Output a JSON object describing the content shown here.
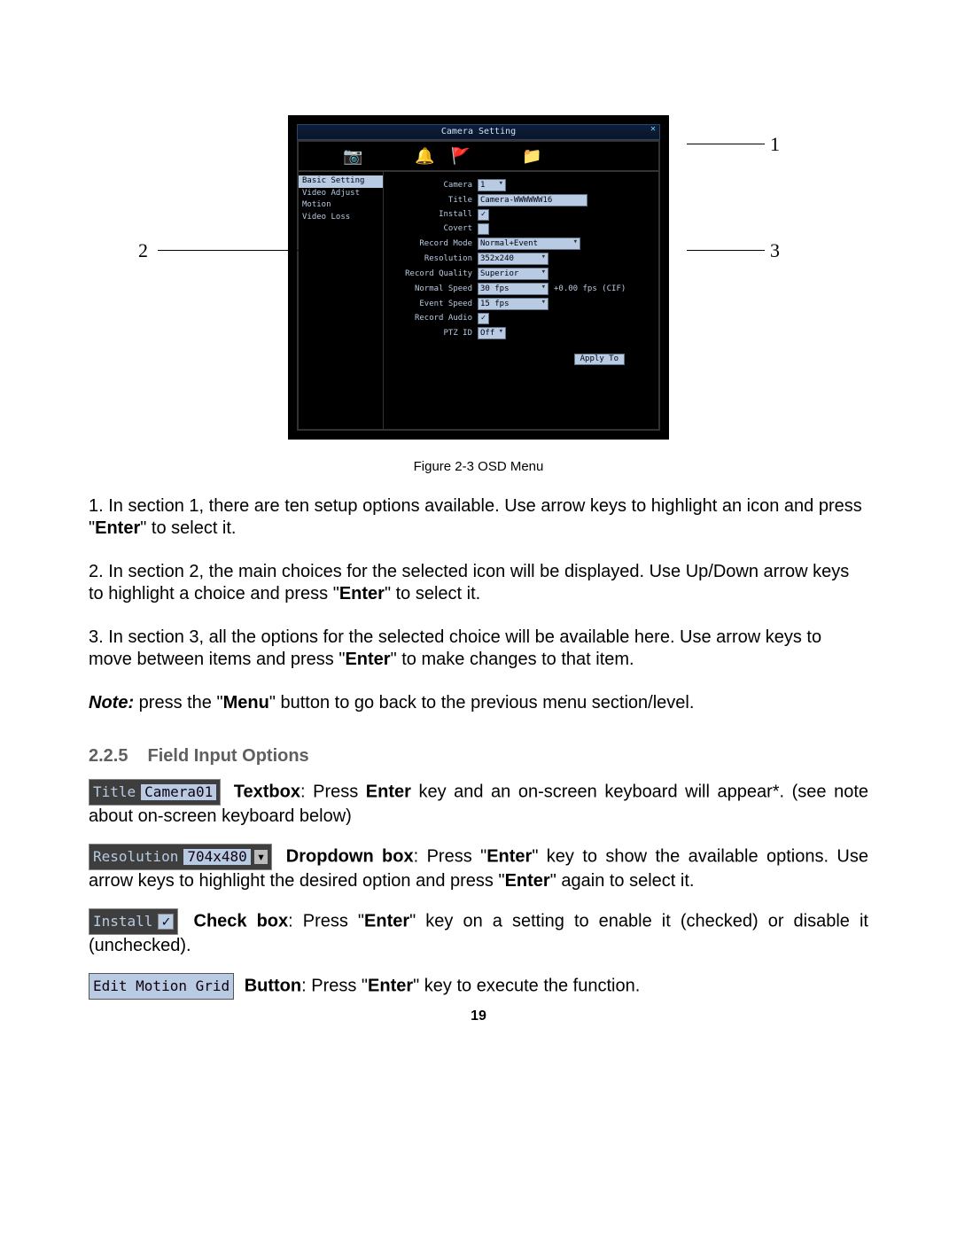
{
  "osd": {
    "title": "Camera Setting",
    "sidebar": [
      "Basic Setting",
      "Video Adjust",
      "Motion",
      "Video Loss"
    ],
    "rows": {
      "camera_lbl": "Camera",
      "camera_val": "1",
      "title_lbl": "Title",
      "title_val": "Camera-WWWWWW16",
      "install_lbl": "Install",
      "covert_lbl": "Covert",
      "recmode_lbl": "Record Mode",
      "recmode_val": "Normal+Event",
      "res_lbl": "Resolution",
      "res_val": "352x240",
      "recq_lbl": "Record Quality",
      "recq_val": "Superior",
      "nspd_lbl": "Normal Speed",
      "nspd_val": "30 fps",
      "nspd_extra": "+0.00 fps (CIF)",
      "espd_lbl": "Event Speed",
      "espd_val": "15 fps",
      "raudio_lbl": "Record Audio",
      "ptz_lbl": "PTZ ID",
      "ptz_val": "Off"
    },
    "apply": "Apply To"
  },
  "callouts": {
    "c1": "1",
    "c2": "2",
    "c3": "3"
  },
  "caption": "Figure 2-3 OSD Menu",
  "p1a": "1. In section 1, there are ten setup options available. Use arrow keys to highlight an icon and press \"",
  "p1b": "Enter",
  "p1c": "\" to select it.",
  "p2a": "2. In section 2, the main choices for the selected icon will be displayed. Use Up/Down arrow keys to highlight a choice and press \"",
  "p2b": "Enter",
  "p2c": "\" to select it.",
  "p3a": "3. In section 3, all the options for the selected choice will be available here. Use arrow keys to move between items and press \"",
  "p3b": "Enter",
  "p3c": "\" to make changes to that item.",
  "note_lbl": "Note:",
  "note_a": " press the \"",
  "note_b": "Menu",
  "note_c": "\" button to go back to the previous menu section/level.",
  "h_num": "2.2.5",
  "h_txt": "Field Input Options",
  "ex1": {
    "lbl": "Title",
    "val": "Camera01",
    "name": "Textbox",
    "txt1": ": Press ",
    "b": "Enter",
    "txt2": " key and an on-screen keyboard will appear*. (see note about on-screen keyboard below)"
  },
  "ex2": {
    "lbl": "Resolution",
    "val": "704x480",
    "name": "Dropdown box",
    "txt1": ": Press \"",
    "b1": "Enter",
    "txt2": "\" key to show the available options. Use arrow keys to highlight the desired option and press \"",
    "b2": "Enter",
    "txt3": "\" again to select it."
  },
  "ex3": {
    "lbl": "Install",
    "name": "Check box",
    "txt1": ": Press \"",
    "b": "Enter",
    "txt2": "\" key on a setting to enable it (checked) or disable it (unchecked)."
  },
  "ex4": {
    "lbl": "Edit Motion Grid",
    "name": "Button",
    "txt1": ": Press \"",
    "b": "Enter",
    "txt2": "\" key to execute the function."
  },
  "page_num": "19"
}
